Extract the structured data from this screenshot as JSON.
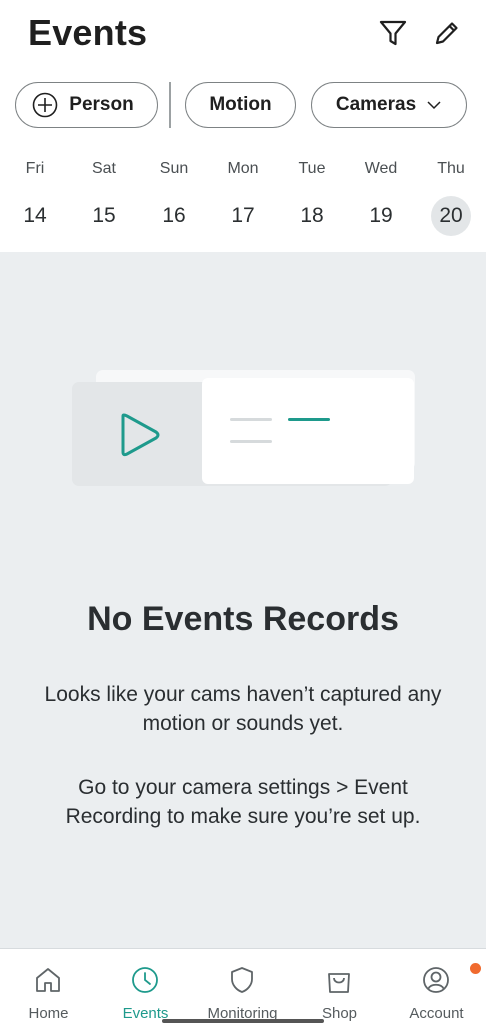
{
  "header": {
    "title": "Events"
  },
  "filters": {
    "person": "Person",
    "motion": "Motion",
    "cameras": "Cameras"
  },
  "week": [
    {
      "name": "Fri",
      "num": "14",
      "selected": false
    },
    {
      "name": "Sat",
      "num": "15",
      "selected": false
    },
    {
      "name": "Sun",
      "num": "16",
      "selected": false
    },
    {
      "name": "Mon",
      "num": "17",
      "selected": false
    },
    {
      "name": "Tue",
      "num": "18",
      "selected": false
    },
    {
      "name": "Wed",
      "num": "19",
      "selected": false
    },
    {
      "name": "Thu",
      "num": "20",
      "selected": true
    }
  ],
  "empty": {
    "title": "No Events Records",
    "text1": "Looks like your cams haven’t captured any motion or sounds yet.",
    "text2": "Go to your camera settings > Event Recording to make sure you’re set up."
  },
  "tabs": [
    {
      "label": "Home",
      "icon": "home-icon"
    },
    {
      "label": "Events",
      "icon": "clock-icon",
      "active": true
    },
    {
      "label": "Monitoring",
      "icon": "shield-icon"
    },
    {
      "label": "Shop",
      "icon": "shopping-bag-icon"
    },
    {
      "label": "Account",
      "icon": "user-circle-icon",
      "badge": true
    }
  ],
  "colors": {
    "accent": "#1e9a8c",
    "badge": "#f06a2e",
    "background": "#ebeef0"
  }
}
